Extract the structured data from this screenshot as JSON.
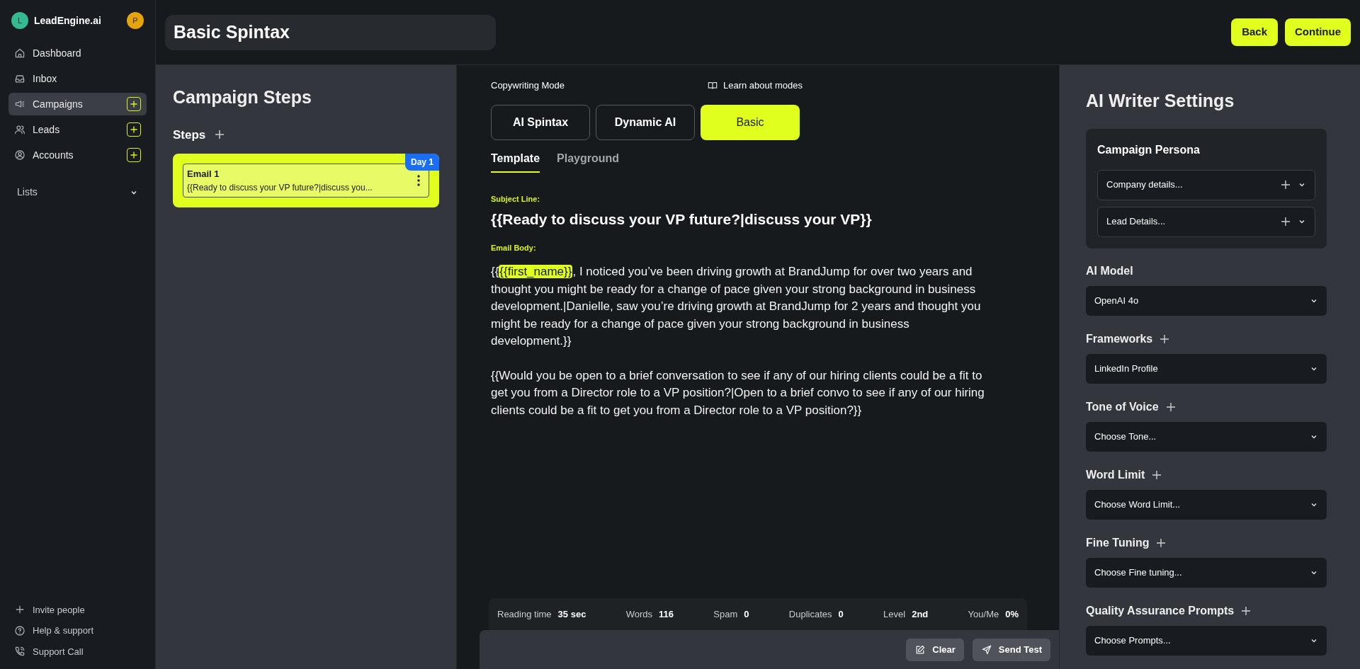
{
  "brand": {
    "initial": "L",
    "name": "LeadEngine.ai",
    "user_initial": "P"
  },
  "sidebar": {
    "items": [
      {
        "label": "Dashboard",
        "selected": false,
        "add": false
      },
      {
        "label": "Inbox",
        "selected": false,
        "add": false
      },
      {
        "label": "Campaigns",
        "selected": true,
        "add": true
      },
      {
        "label": "Leads",
        "selected": false,
        "add": true
      },
      {
        "label": "Accounts",
        "selected": false,
        "add": true
      }
    ],
    "lists": {
      "label": "Lists",
      "expanded": false
    },
    "footer": [
      {
        "label": "Invite people"
      },
      {
        "label": "Help & support"
      },
      {
        "label": "Support Call"
      }
    ]
  },
  "header": {
    "title": "Basic Spintax",
    "buttons": [
      "Back",
      "Continue"
    ]
  },
  "steps_panel": {
    "title": "Campaign Steps",
    "steps_label": "Steps",
    "steps": [
      {
        "name": "Email 1",
        "preview": "{{Ready to discuss your VP future?|discuss you...",
        "badge": "Day 1",
        "selected": true
      }
    ]
  },
  "editor": {
    "mode_label": "Copywriting Mode",
    "learn_link": "Learn about modes",
    "modes": [
      {
        "label": "AI Spintax",
        "selected": false
      },
      {
        "label": "Dynamic AI",
        "selected": false
      },
      {
        "label": "Basic",
        "selected": true
      }
    ],
    "tabs": [
      {
        "label": "Template",
        "selected": true
      },
      {
        "label": "Playground",
        "selected": false
      }
    ],
    "subject_label": "Subject Line:",
    "subject": "{{Ready to discuss your VP future?|discuss your VP}}",
    "body_label": "Email Body:",
    "body": [
      [
        {
          "kind": "text",
          "text": "{{"
        },
        {
          "kind": "variable",
          "text": "{{first_name}}"
        },
        {
          "kind": "text",
          "text": ", I noticed you’ve been driving growth at BrandJump for over two years and thought you might be ready for a change of pace given your strong background in business development.|Danielle, saw you’re driving growth at BrandJump for 2 years and thought you might be ready for a change of pace given your strong background in business development.}}"
        }
      ],
      [
        {
          "kind": "text",
          "text": "{{Would you be open to a brief conversation to see if any of our hiring clients could be a fit to get you from a Director role to a VP position?|Open to a brief convo to see if any of our hiring clients could be a fit to get you from a Director role to a VP position?}}"
        }
      ]
    ],
    "stats": [
      {
        "label": "Reading time",
        "value": "35 sec"
      },
      {
        "label": "Words",
        "value": "116"
      },
      {
        "label": "Spam",
        "value": "0"
      },
      {
        "label": "Duplicates",
        "value": "0"
      },
      {
        "label": "Level",
        "value": "2nd"
      },
      {
        "label": "You/Me",
        "value": "0%"
      }
    ],
    "actions": [
      {
        "label": "Clear"
      },
      {
        "label": "Send Test"
      }
    ]
  },
  "settings": {
    "title": "AI Writer Settings",
    "persona": {
      "title": "Campaign Persona",
      "fields": [
        "Company details...",
        "Lead Details..."
      ]
    },
    "sections": [
      {
        "label": "AI Model",
        "add": false,
        "value": "OpenAI 4o"
      },
      {
        "label": "Frameworks",
        "add": true,
        "value": "LinkedIn Profile"
      },
      {
        "label": "Tone of Voice",
        "add": true,
        "value": "Choose Tone..."
      },
      {
        "label": "Word Limit",
        "add": true,
        "value": "Choose Word Limit..."
      },
      {
        "label": "Fine Tuning",
        "add": true,
        "value": "Choose Fine tuning..."
      },
      {
        "label": "Quality Assurance Prompts",
        "add": true,
        "value": "Choose Prompts..."
      }
    ]
  }
}
